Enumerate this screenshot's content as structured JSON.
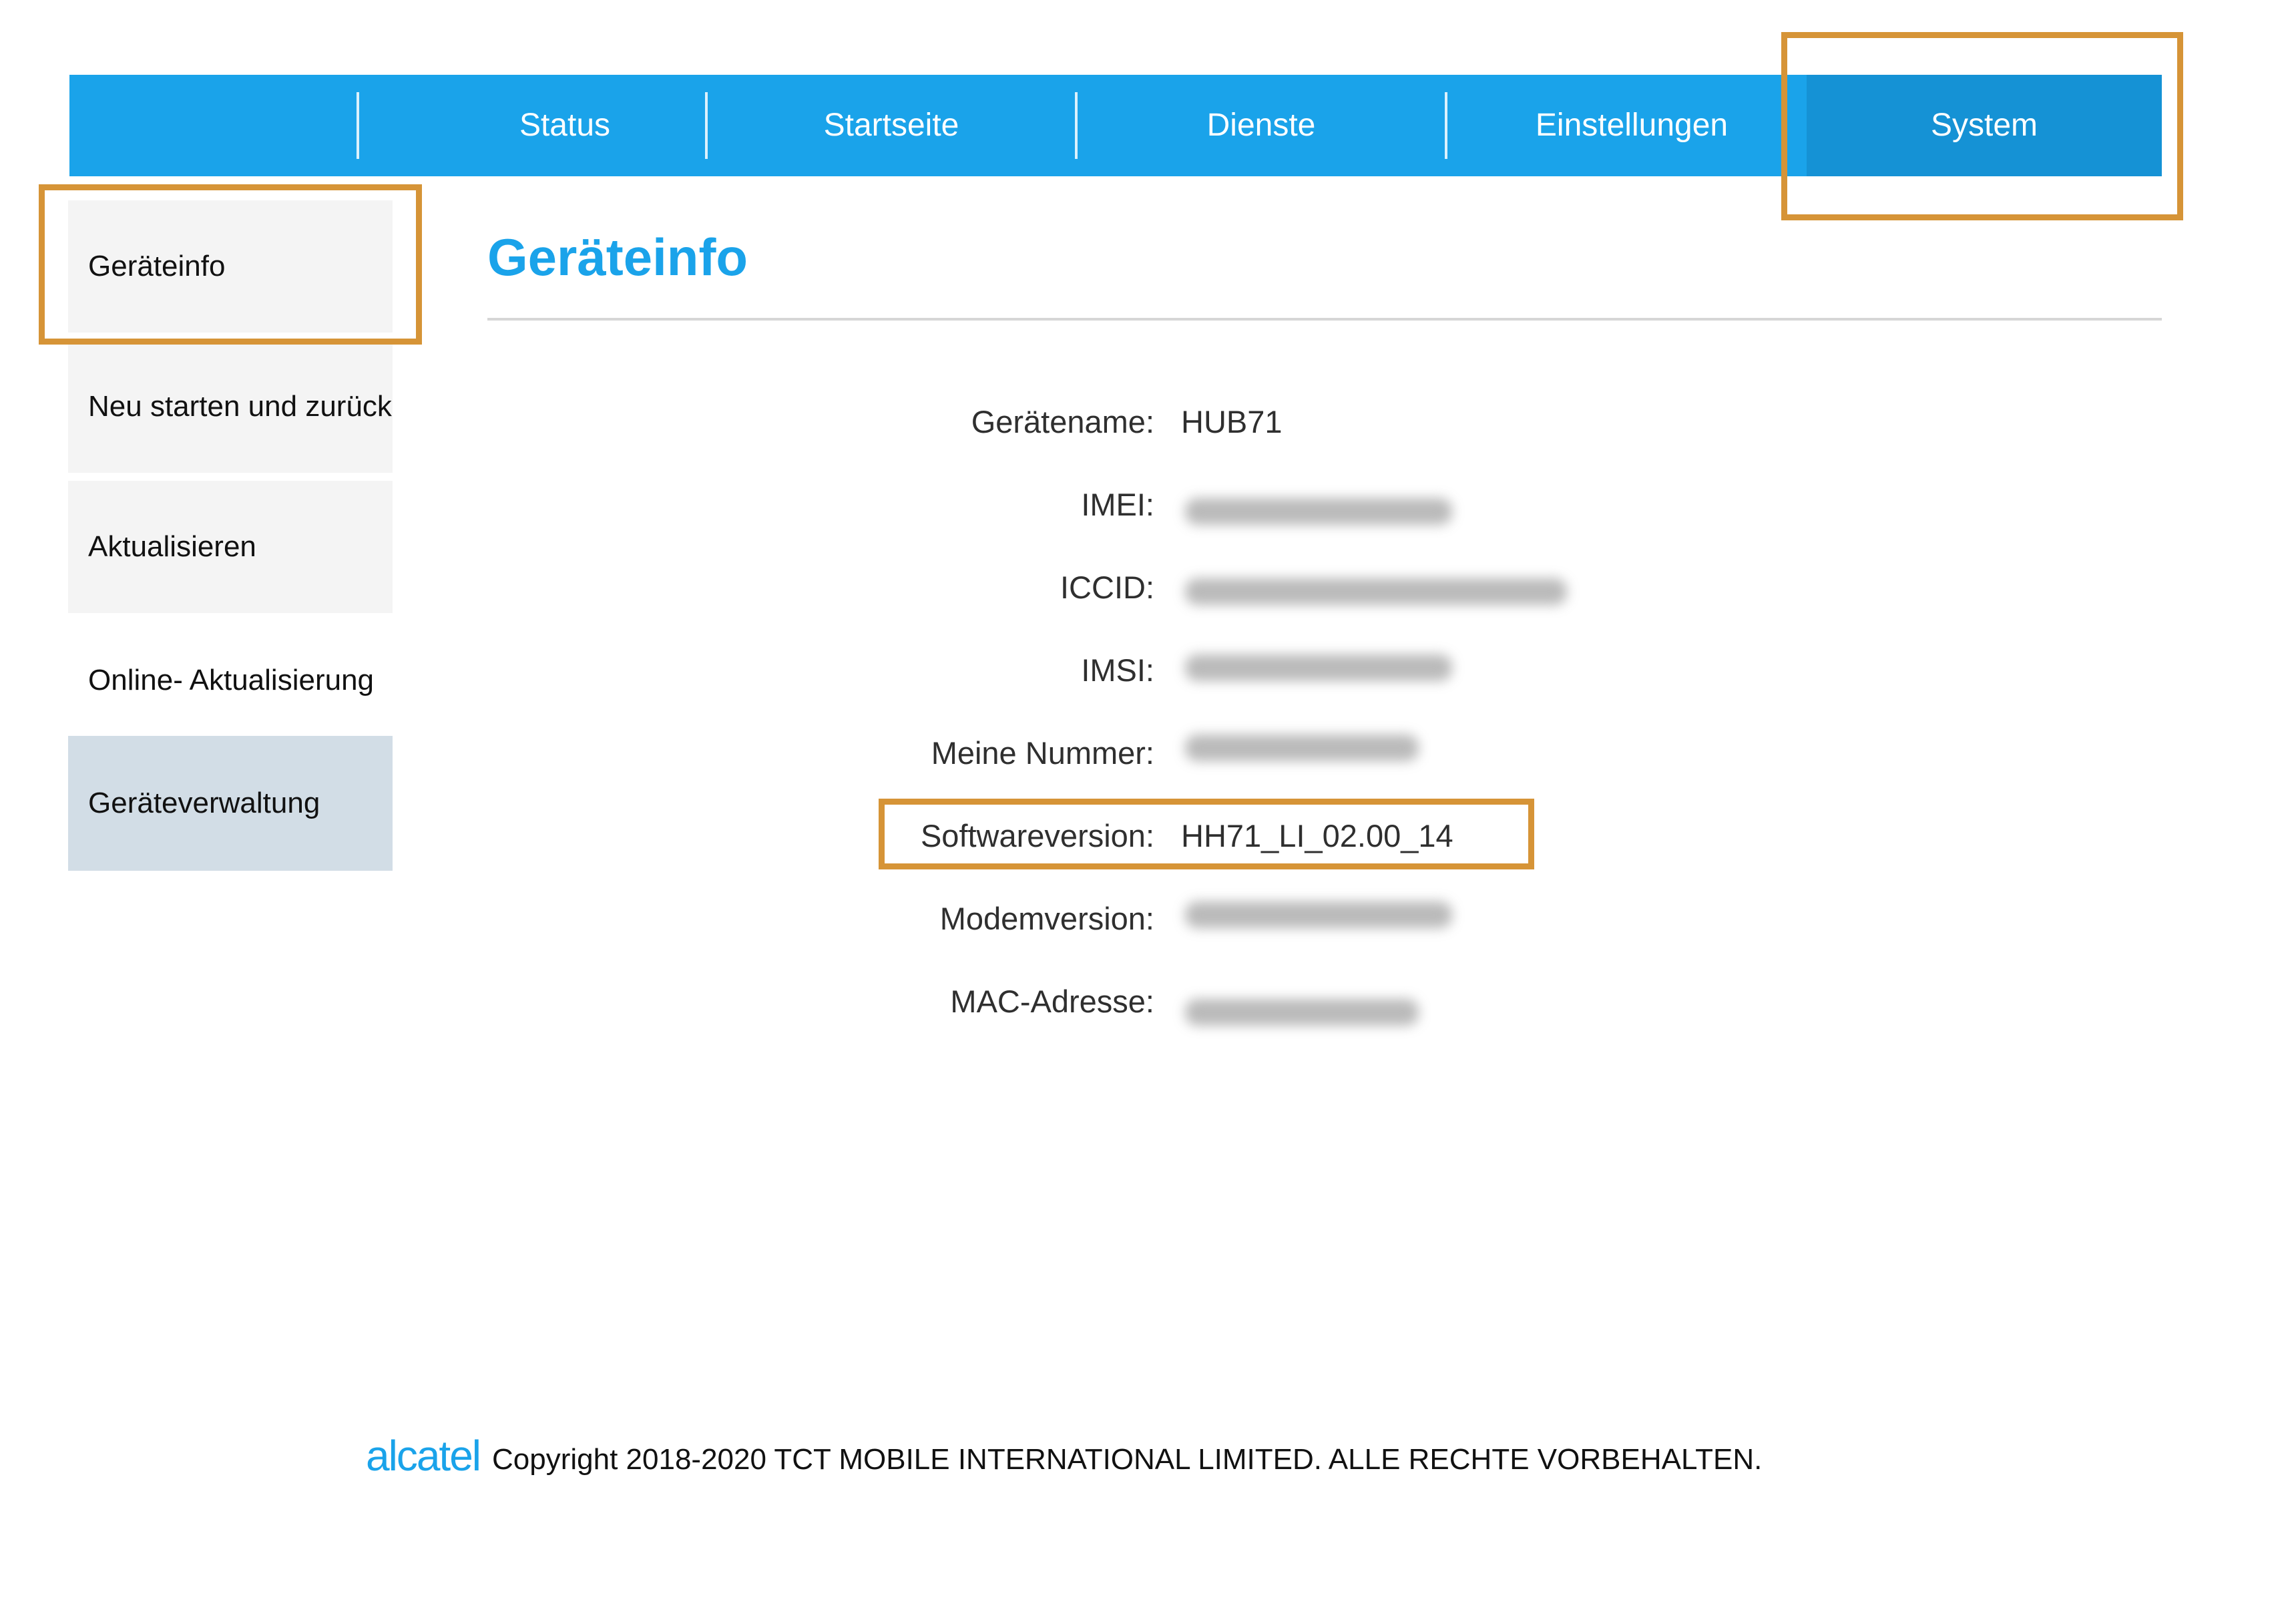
{
  "nav": {
    "items": [
      "Status",
      "Startseite",
      "Dienste",
      "Einstellungen",
      "System"
    ],
    "active": "System"
  },
  "sidebar": {
    "items": [
      {
        "label": "Geräteinfo"
      },
      {
        "label": "Neu starten und zurücksetzen"
      },
      {
        "label": "Aktualisieren"
      },
      {
        "label": "Online- Aktualisierung"
      },
      {
        "label": "Geräteverwaltung"
      }
    ]
  },
  "main": {
    "title": "Geräteinfo",
    "fields": [
      {
        "label": "Gerätename:",
        "value": "HUB71"
      },
      {
        "label": "IMEI:",
        "value": null,
        "redacted": true
      },
      {
        "label": "ICCID:",
        "value": null,
        "redacted": true
      },
      {
        "label": "IMSI:",
        "value": null,
        "redacted": true
      },
      {
        "label": "Meine Nummer:",
        "value": null,
        "redacted": true
      },
      {
        "label": "Softwareversion:",
        "value": "HH71_LI_02.00_14"
      },
      {
        "label": "Modemversion:",
        "value": null,
        "redacted": true
      },
      {
        "label": "MAC-Adresse:",
        "value": null,
        "redacted": true
      }
    ]
  },
  "footer": {
    "logo": "alcatel",
    "copyright": "Copyright 2018-2020 TCT MOBILE INTERNATIONAL LIMITED. ALLE RECHTE VORBEHALTEN."
  },
  "colors": {
    "accent": "#1aa3ea",
    "highlight": "#d69437"
  }
}
